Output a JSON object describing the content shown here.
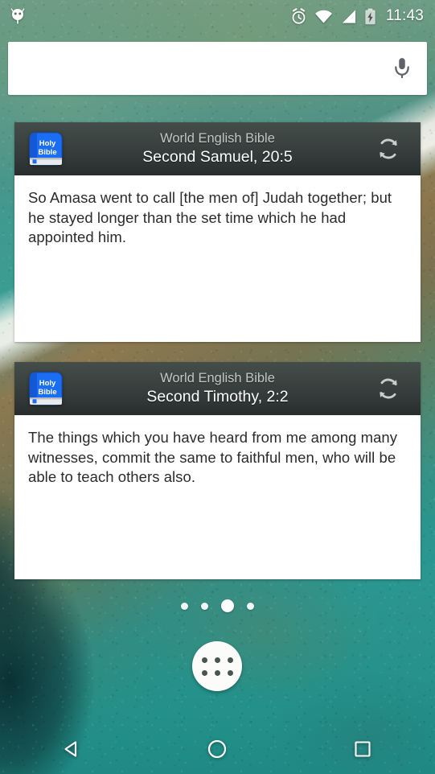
{
  "status_bar": {
    "notification_icon": "android-robot-icon",
    "icons": [
      "alarm-icon",
      "wifi-icon",
      "cell-signal-icon",
      "battery-charging-icon"
    ],
    "clock": "11:43"
  },
  "search": {
    "value": "",
    "placeholder": "",
    "mic_icon": "microphone-icon"
  },
  "widgets": [
    {
      "app_icon_line1": "Holy",
      "app_icon_line2": "Bible",
      "version": "World English Bible",
      "reference": "Second Samuel, 20:5",
      "verse": "So Amasa went to call [the men of] Judah together; but he stayed longer than the set time which he had appointed him.",
      "refresh_icon": "refresh-icon"
    },
    {
      "app_icon_line1": "Holy",
      "app_icon_line2": "Bible",
      "version": "World English Bible",
      "reference": "Second Timothy, 2:2",
      "verse": "The things which you have heard from me among many witnesses, commit the same to faithful men, who will be able to teach others also.",
      "refresh_icon": "refresh-icon"
    }
  ],
  "page_indicator": {
    "total_pages": 4,
    "active_page": 3
  },
  "app_drawer": {
    "label": "All apps",
    "icon": "apps-grid-icon"
  },
  "nav_bar": {
    "back_label": "Back",
    "home_label": "Home",
    "recents_label": "Recent apps"
  },
  "colors": {
    "widget_header_top": "#454d4b",
    "widget_header_bottom": "#272d2c",
    "widget_body": "#ffffff",
    "bible_icon_blue": "#1b6ef3",
    "verse_text": "#2b2b2b",
    "wallpaper_teal": "#2f9a92"
  }
}
